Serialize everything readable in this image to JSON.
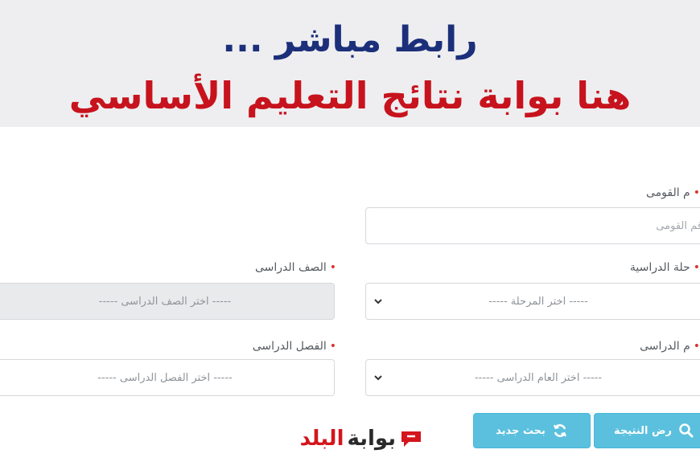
{
  "banner": {
    "line1": "رابط مباشر ...",
    "line2": "هنا بوابة نتائج التعليم الأساسي"
  },
  "form": {
    "national_id": {
      "label": "م القومى",
      "placeholder": "قم القومى"
    },
    "stage": {
      "label": "حلة الدراسية",
      "value": "----- اختر المرحلة -----"
    },
    "grade": {
      "label": "الصف الدراسى",
      "value": "----- اختر الصف الدراسى -----"
    },
    "year": {
      "label": "م الدراسى",
      "value": "----- اختر العام الدراسى -----"
    },
    "term": {
      "label": "الفصل الدراسى",
      "value": "----- اختر الفصل الدراسى -----"
    },
    "required_mark": "•"
  },
  "buttons": {
    "show_result": "رض النتيجة",
    "new_search": "بحث جديد"
  },
  "watermark": {
    "part1": "بوابة",
    "part2": "البلد"
  },
  "colors": {
    "banner_bg": "#eeeef0",
    "title_blue": "#1c2f7a",
    "title_red": "#c7131d",
    "button": "#5bc0de",
    "required": "#d9342b"
  }
}
